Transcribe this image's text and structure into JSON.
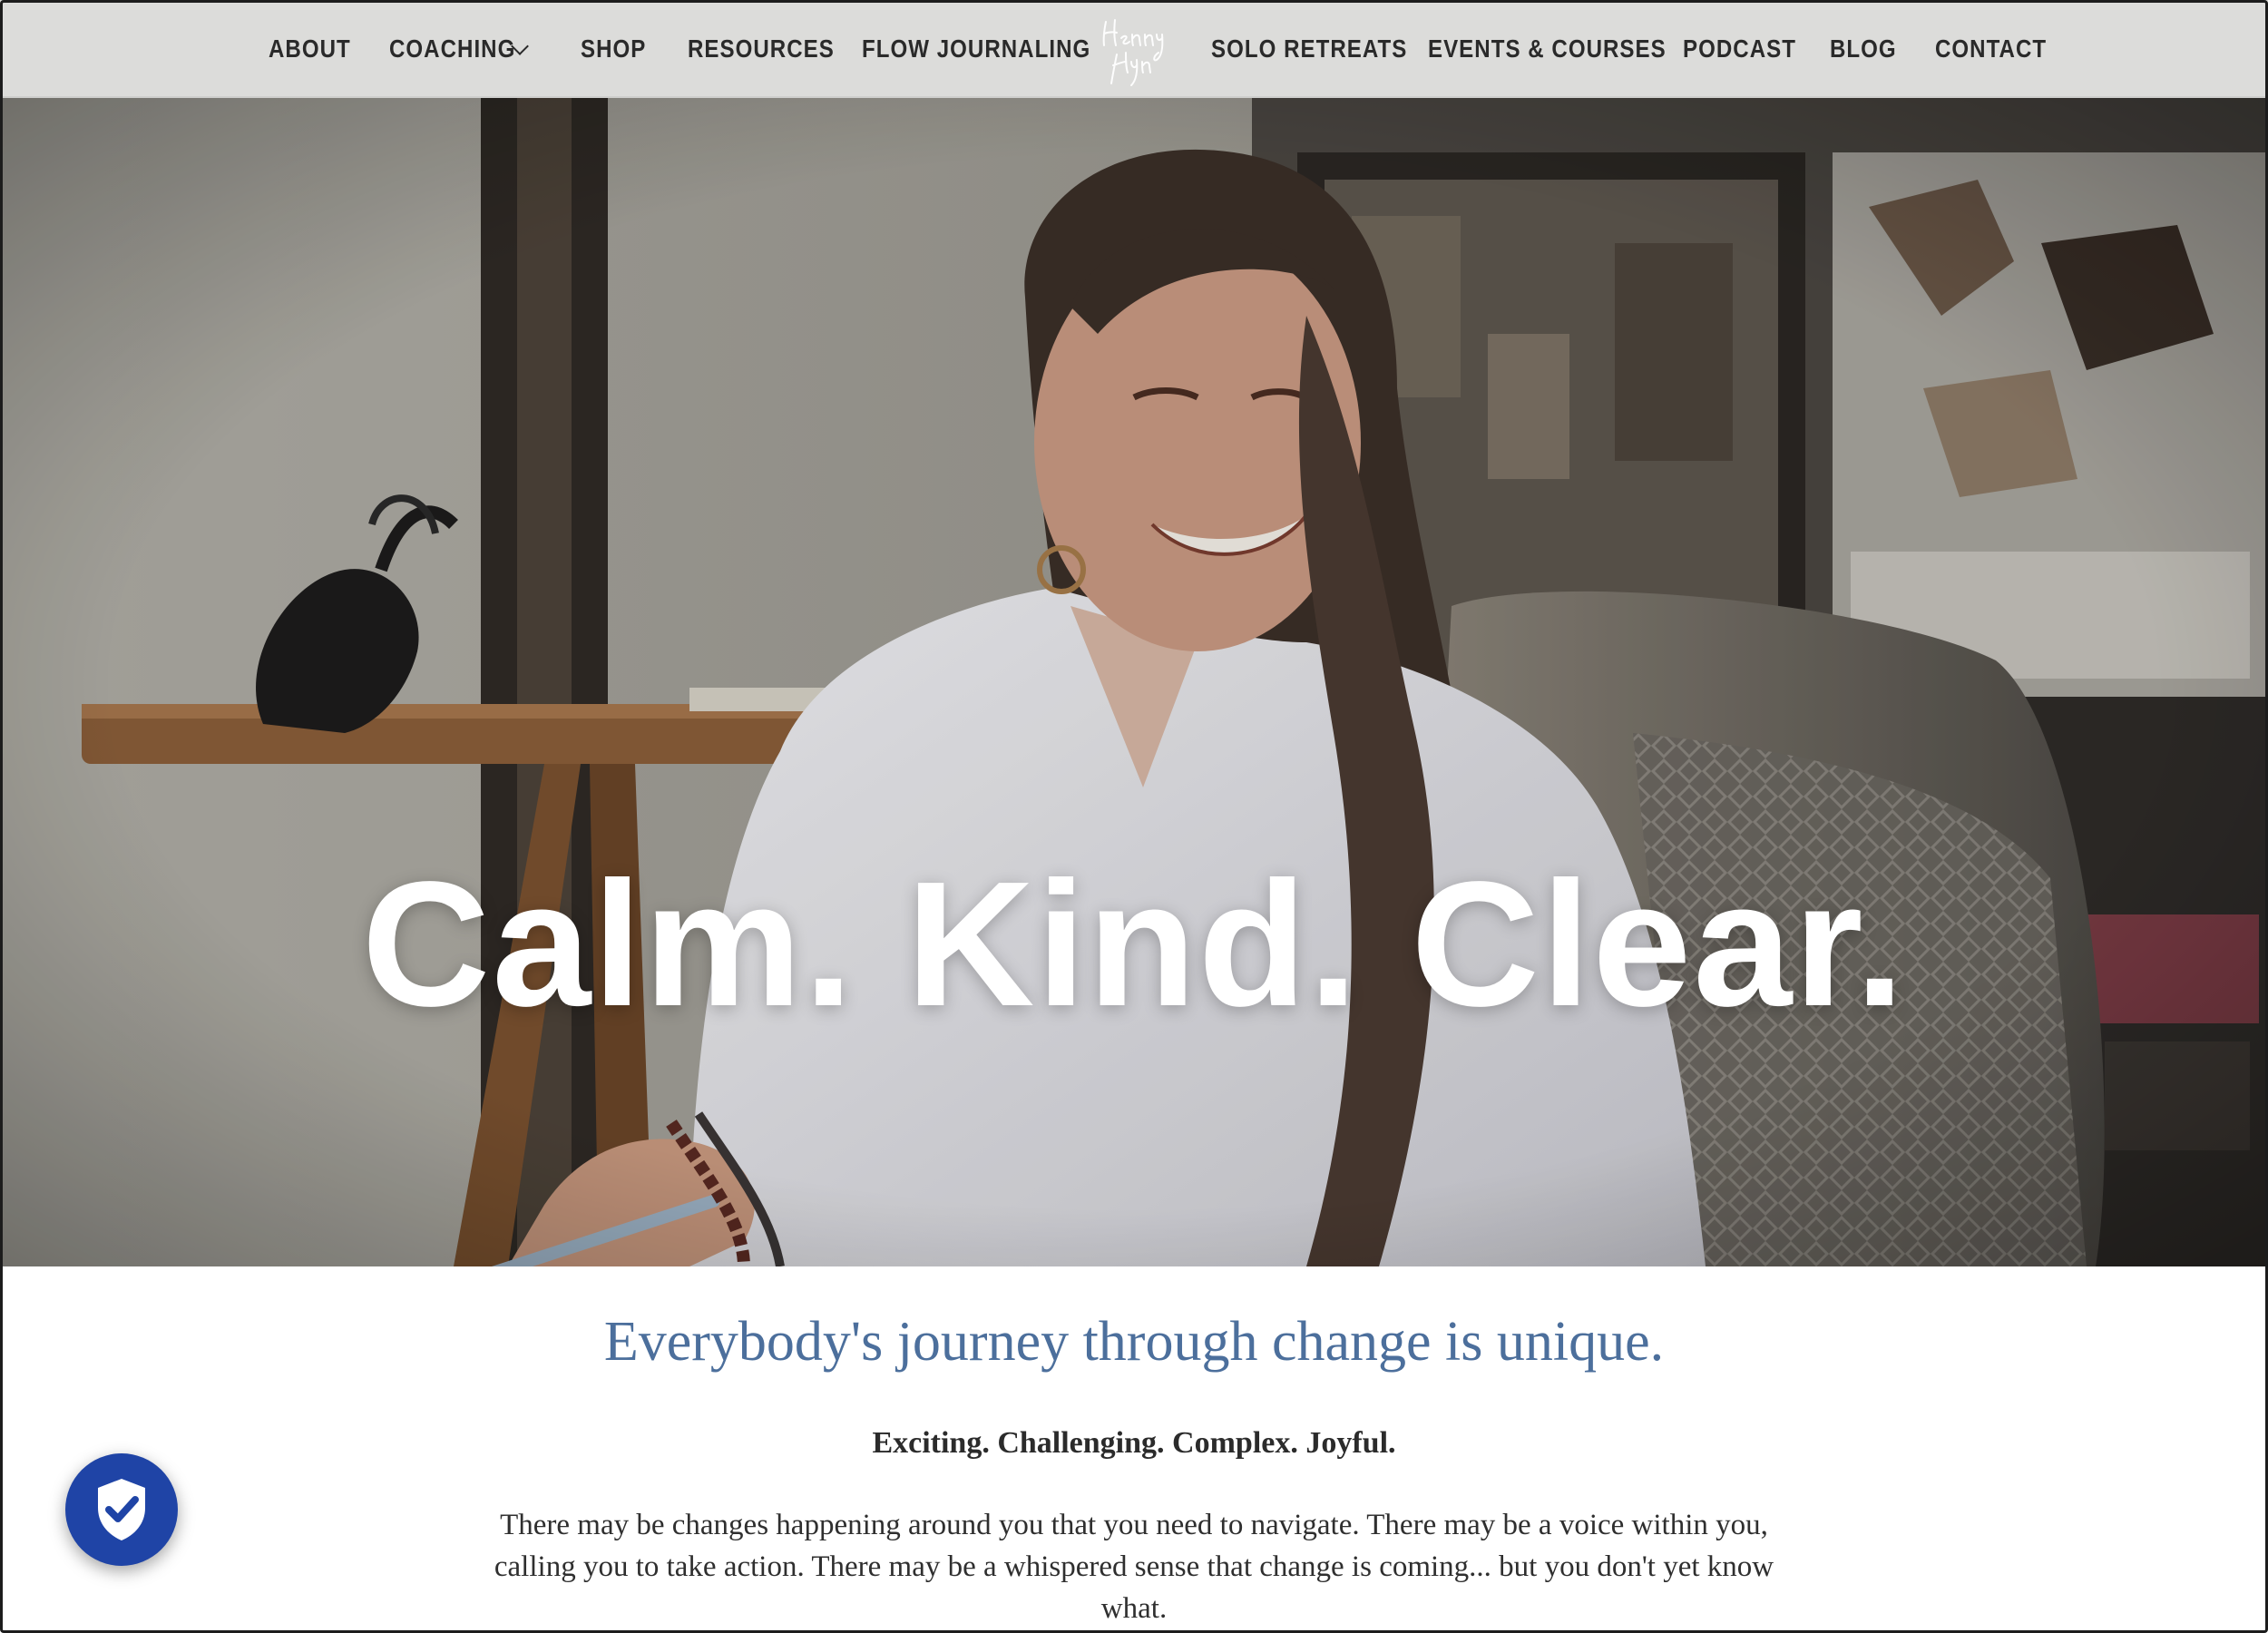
{
  "nav": {
    "items": [
      {
        "label": "ABOUT"
      },
      {
        "label": "COACHING"
      },
      {
        "label": "SHOP"
      },
      {
        "label": "RESOURCES"
      },
      {
        "label": "FLOW JOURNALING"
      },
      {
        "label": "SOLO RETREATS"
      },
      {
        "label": "EVENTS & COURSES"
      },
      {
        "label": "PODCAST"
      },
      {
        "label": "BLOG"
      },
      {
        "label": "CONTACT"
      }
    ],
    "logo_text": [
      "Henny",
      "Flynn"
    ]
  },
  "hero": {
    "title": "Calm. Kind. Clear."
  },
  "main": {
    "headline": "Everybody's journey through change is unique.",
    "subhead": "Exciting. Challenging. Complex. Joyful.",
    "paragraph": "There may be changes happening around you that you need to navigate. There may be a voice within you, calling you to take action. There may be a whispered sense that change is coming... but you don't yet know what."
  },
  "privacy_badge": {
    "icon": "shield-check-icon",
    "color": "#1f44a6"
  },
  "colors": {
    "nav_bg": "#dcdcda",
    "headline": "#4c6f9c"
  }
}
